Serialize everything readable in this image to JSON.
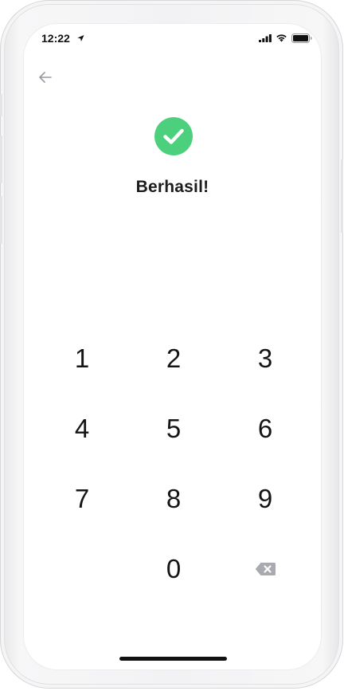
{
  "status_bar": {
    "time": "12:22",
    "icons": [
      "location-arrow-icon",
      "signal-icon",
      "wifi-icon",
      "battery-icon"
    ]
  },
  "nav": {
    "back_icon": "arrow-left-icon"
  },
  "result": {
    "icon": "check-circle-icon",
    "title": "Berhasil!"
  },
  "keypad": {
    "keys": [
      "1",
      "2",
      "3",
      "4",
      "5",
      "6",
      "7",
      "8",
      "9",
      "0"
    ],
    "backspace_icon": "backspace-icon"
  },
  "colors": {
    "success": "#4cd07d",
    "text": "#1c1c1e",
    "icon_muted": "#a9a9b0"
  }
}
